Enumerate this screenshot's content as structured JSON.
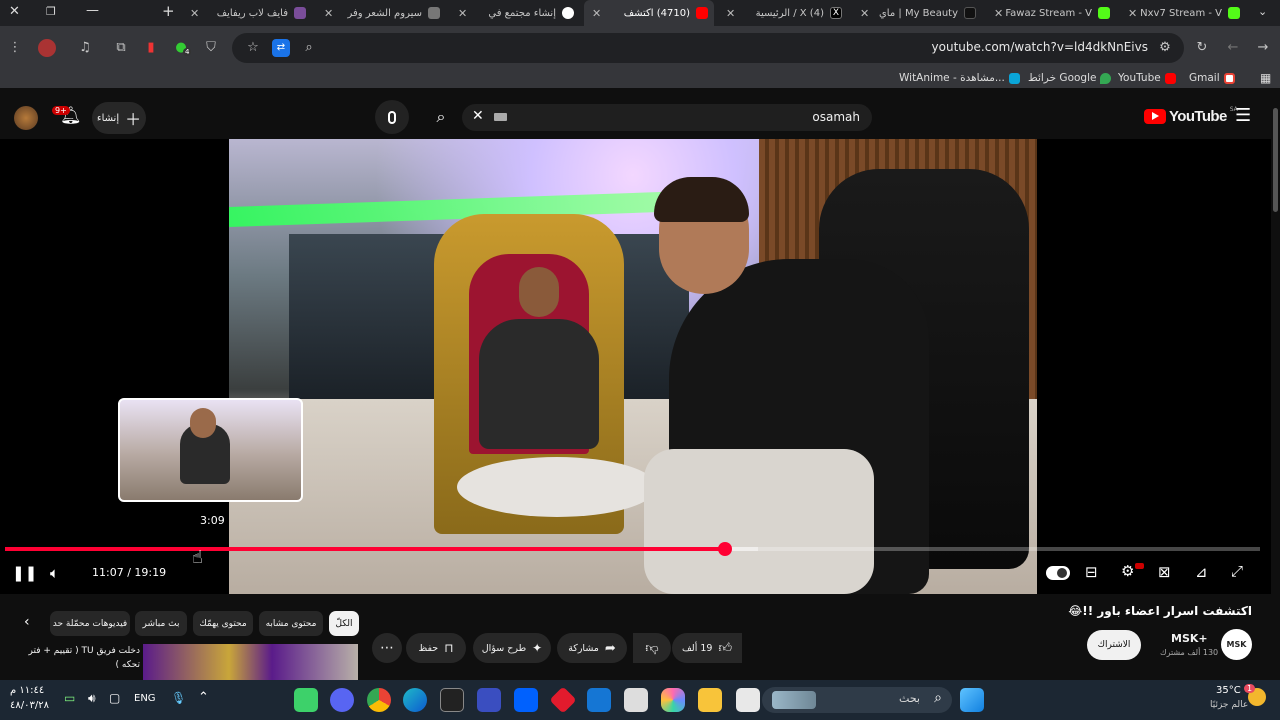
{
  "tabs": [
    {
      "title": "Nxv7 Stream - V",
      "favicon": "kick-icon",
      "color": "#53fc18"
    },
    {
      "title": "Fawaz Stream - V",
      "favicon": "kick-icon",
      "color": "#53fc18"
    },
    {
      "title": "My Beauty | ماي",
      "favicon": "tiktok-icon",
      "color": "#111111"
    },
    {
      "title": "(4) X / الرئيسية",
      "favicon": "x-icon",
      "color": "#000000"
    },
    {
      "title": "(4710) اكتشف",
      "favicon": "youtube-icon",
      "color": "#ff0000"
    },
    {
      "title": "إنشاء مجتمع في",
      "favicon": "community-icon",
      "color": "#ffffff"
    },
    {
      "title": "سيروم الشعر وفر",
      "favicon": "shop-icon",
      "color": "#777777"
    },
    {
      "title": "فايف لاب ريفايف",
      "favicon": "shop-icon",
      "color": "#7a4d9a"
    }
  ],
  "toolbar": {
    "url": "youtube.com/watch?v=ld4dkNnEivs",
    "extension_badge": "4"
  },
  "bookmarks": [
    {
      "label": "Gmail",
      "color": "#ea4335"
    },
    {
      "label": "YouTube",
      "color": "#ff0000"
    },
    {
      "label": "خرائط Google",
      "color": "#34a853"
    },
    {
      "label": "WitAnime - مشاهدة...",
      "color": "#0aa5d8"
    }
  ],
  "yt_header": {
    "logo": "YouTube",
    "region": "SA",
    "search_value": "osamah",
    "create_label": "إنشاء",
    "notif_count": "9+"
  },
  "player": {
    "current_time": "11:07",
    "duration": "19:19",
    "preview_time": "3:09",
    "played_fraction": 0.574,
    "buffered_fraction": 0.6
  },
  "video": {
    "title": "اكتشفت اسرار اعضاء باور !!😂",
    "channel": "MSK+",
    "subscribers": "130 ألف مشترك",
    "subscribe_label": "الاشتراك",
    "likes": "19 ألف",
    "share_label": "مشاركة",
    "ask_label": "طرح سؤال",
    "save_label": "حفظ"
  },
  "chips": [
    {
      "label": "الكلّ",
      "active": true
    },
    {
      "label": "محتوى مشابه",
      "active": false
    },
    {
      "label": "محتوى يهمّك",
      "active": false
    },
    {
      "label": "بث مباشر",
      "active": false
    },
    {
      "label": "فيديوهات محمّلة حد",
      "active": false
    }
  ],
  "recommendation": {
    "title": "دخلت فريق TU ( تقييم + فترة تجربة )",
    "title2": "تحكه )"
  },
  "taskbar": {
    "weather_temp": "35°C",
    "weather_text": "عالم جزئيًا",
    "search_placeholder": "بحث",
    "lang": "ENG",
    "time": "١١:٤٤ م",
    "date": "٤٨/٠٣/٢٨",
    "weather_badge": "1"
  }
}
